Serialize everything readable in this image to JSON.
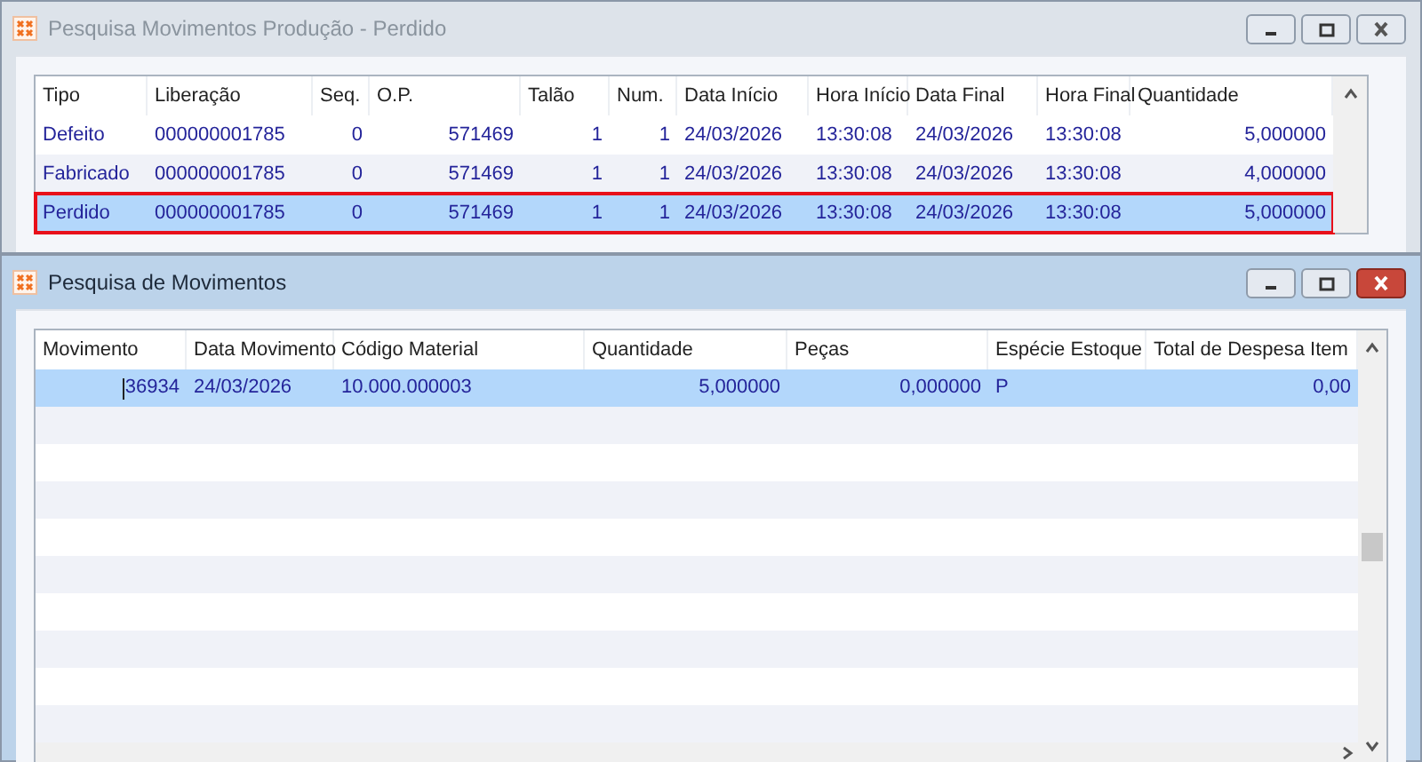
{
  "windows": [
    {
      "title": "Pesquisa Movimentos Produção - Perdido",
      "active": false,
      "table": {
        "columns": [
          "Tipo",
          "Liberação",
          "Seq.",
          "O.P.",
          "Talão",
          "Num.",
          "Data Início",
          "Hora Início",
          "Data Final",
          "Hora Final",
          "Quantidade"
        ],
        "rows": [
          {
            "selected": false,
            "outlined": false,
            "cells": [
              "Defeito",
              "000000001785",
              "0",
              "571469",
              "1",
              "1",
              "24/03/2026",
              "13:30:08",
              "24/03/2026",
              "13:30:08",
              "5,000000"
            ]
          },
          {
            "selected": false,
            "outlined": false,
            "cells": [
              "Fabricado",
              "000000001785",
              "0",
              "571469",
              "1",
              "1",
              "24/03/2026",
              "13:30:08",
              "24/03/2026",
              "13:30:08",
              "4,000000"
            ]
          },
          {
            "selected": true,
            "outlined": true,
            "cells": [
              "Perdido",
              "000000001785",
              "0",
              "571469",
              "1",
              "1",
              "24/03/2026",
              "13:30:08",
              "24/03/2026",
              "13:30:08",
              "5,000000"
            ]
          }
        ]
      }
    },
    {
      "title": "Pesquisa de Movimentos",
      "active": true,
      "table": {
        "columns": [
          "Movimento",
          "Data Movimento",
          "Código Material",
          "Quantidade",
          "Peças",
          "Espécie Estoque",
          "Total de Despesa Item"
        ],
        "rows": [
          {
            "selected": true,
            "outlined": false,
            "editing": true,
            "cells": [
              "36934",
              "24/03/2026",
              "10.000.000003",
              "5,000000",
              "0,000000",
              "P",
              "0,00"
            ]
          }
        ]
      }
    }
  ]
}
